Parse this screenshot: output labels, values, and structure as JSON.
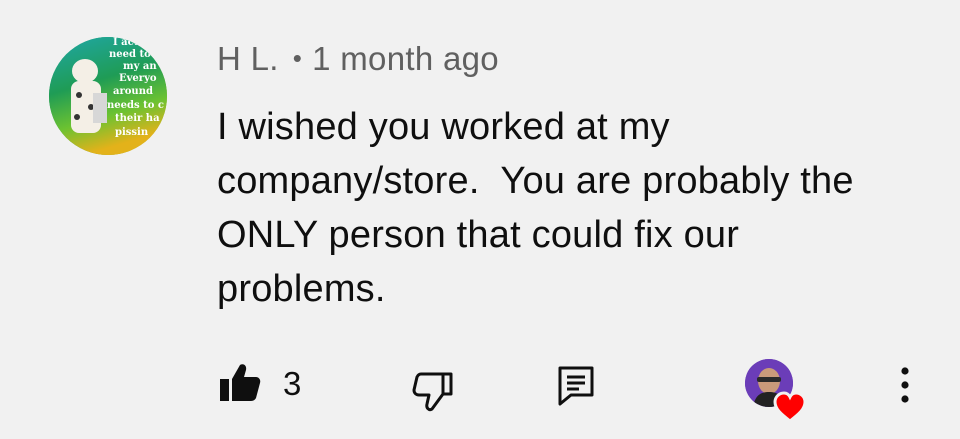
{
  "comment": {
    "author": "H L.",
    "separator": "•",
    "timestamp": "1 month ago",
    "text": "I wished you worked at my company/store.  You are probably the ONLY person that could fix our problems.",
    "avatar_text": [
      "I act",
      "need to",
      "my an",
      "Everyo",
      "around",
      "needs to c",
      "their ha",
      "pissin"
    ]
  },
  "actions": {
    "like_icon": "thumbs-up-icon",
    "like_count": "3",
    "dislike_icon": "thumbs-down-icon",
    "reply_icon": "comment-icon",
    "creator_heart_icon": "heart-icon",
    "more_icon": "more-vertical-icon"
  },
  "colors": {
    "background": "#f1f1f1",
    "text": "#0f0f0f",
    "meta_text": "#606060",
    "heart": "#ff0000"
  }
}
